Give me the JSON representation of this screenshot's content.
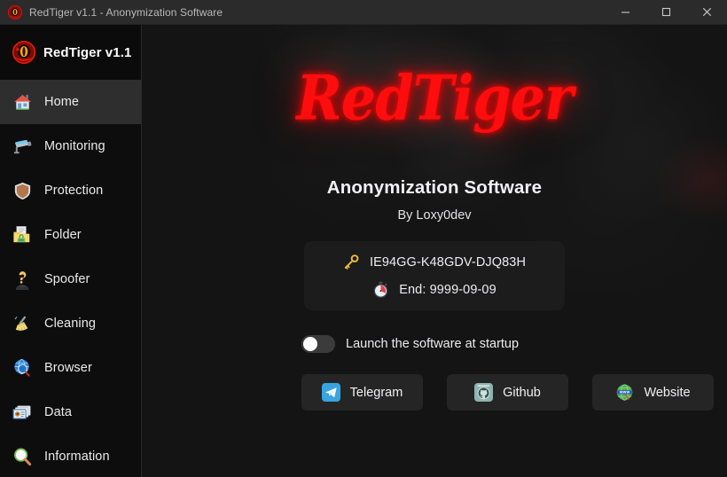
{
  "window": {
    "title": "RedTiger v1.1 - Anonymization Software",
    "logo_icon": "redtiger-eye-icon",
    "controls": {
      "minimize": "minimize-icon",
      "maximize": "maximize-icon",
      "close": "close-icon"
    }
  },
  "sidebar": {
    "brand": {
      "label": "RedTiger v1.1",
      "icon": "redtiger-eye-icon"
    },
    "items": [
      {
        "label": "Home",
        "icon": "house-icon",
        "active": true
      },
      {
        "label": "Monitoring",
        "icon": "cctv-camera-icon",
        "active": false
      },
      {
        "label": "Protection",
        "icon": "shield-icon",
        "active": false
      },
      {
        "label": "Folder",
        "icon": "locked-folder-icon",
        "active": false
      },
      {
        "label": "Spoofer",
        "icon": "spy-question-icon",
        "active": false
      },
      {
        "label": "Cleaning",
        "icon": "broom-icon",
        "active": false
      },
      {
        "label": "Browser",
        "icon": "globe-search-icon",
        "active": false
      },
      {
        "label": "Data",
        "icon": "id-card-icon",
        "active": false
      },
      {
        "label": "Information",
        "icon": "magnifier-icon",
        "active": false
      }
    ]
  },
  "main": {
    "logo_text": "RedTiger",
    "subtitle": "Anonymization Software",
    "byline": "By Loxy0dev",
    "license": {
      "key": "IE94GG-K48GDV-DJQ83H",
      "key_icon": "key-icon",
      "expiry": "End: 9999-09-09",
      "expiry_icon": "stopwatch-icon"
    },
    "startup_toggle": {
      "label": "Launch the software at startup",
      "enabled": false
    },
    "links": [
      {
        "label": "Telegram",
        "icon": "telegram-icon"
      },
      {
        "label": "Github",
        "icon": "github-icon"
      },
      {
        "label": "Website",
        "icon": "globe-www-icon"
      }
    ]
  },
  "colors": {
    "brand_red": "#fd0d0d",
    "sidebar_bg": "#0d0d0d",
    "content_bg": "#141414",
    "titlebar_bg": "#2b2b2b",
    "panel_bg": "#1c1c1c",
    "button_bg": "#252525",
    "active_item_bg": "#2e2e2e"
  }
}
